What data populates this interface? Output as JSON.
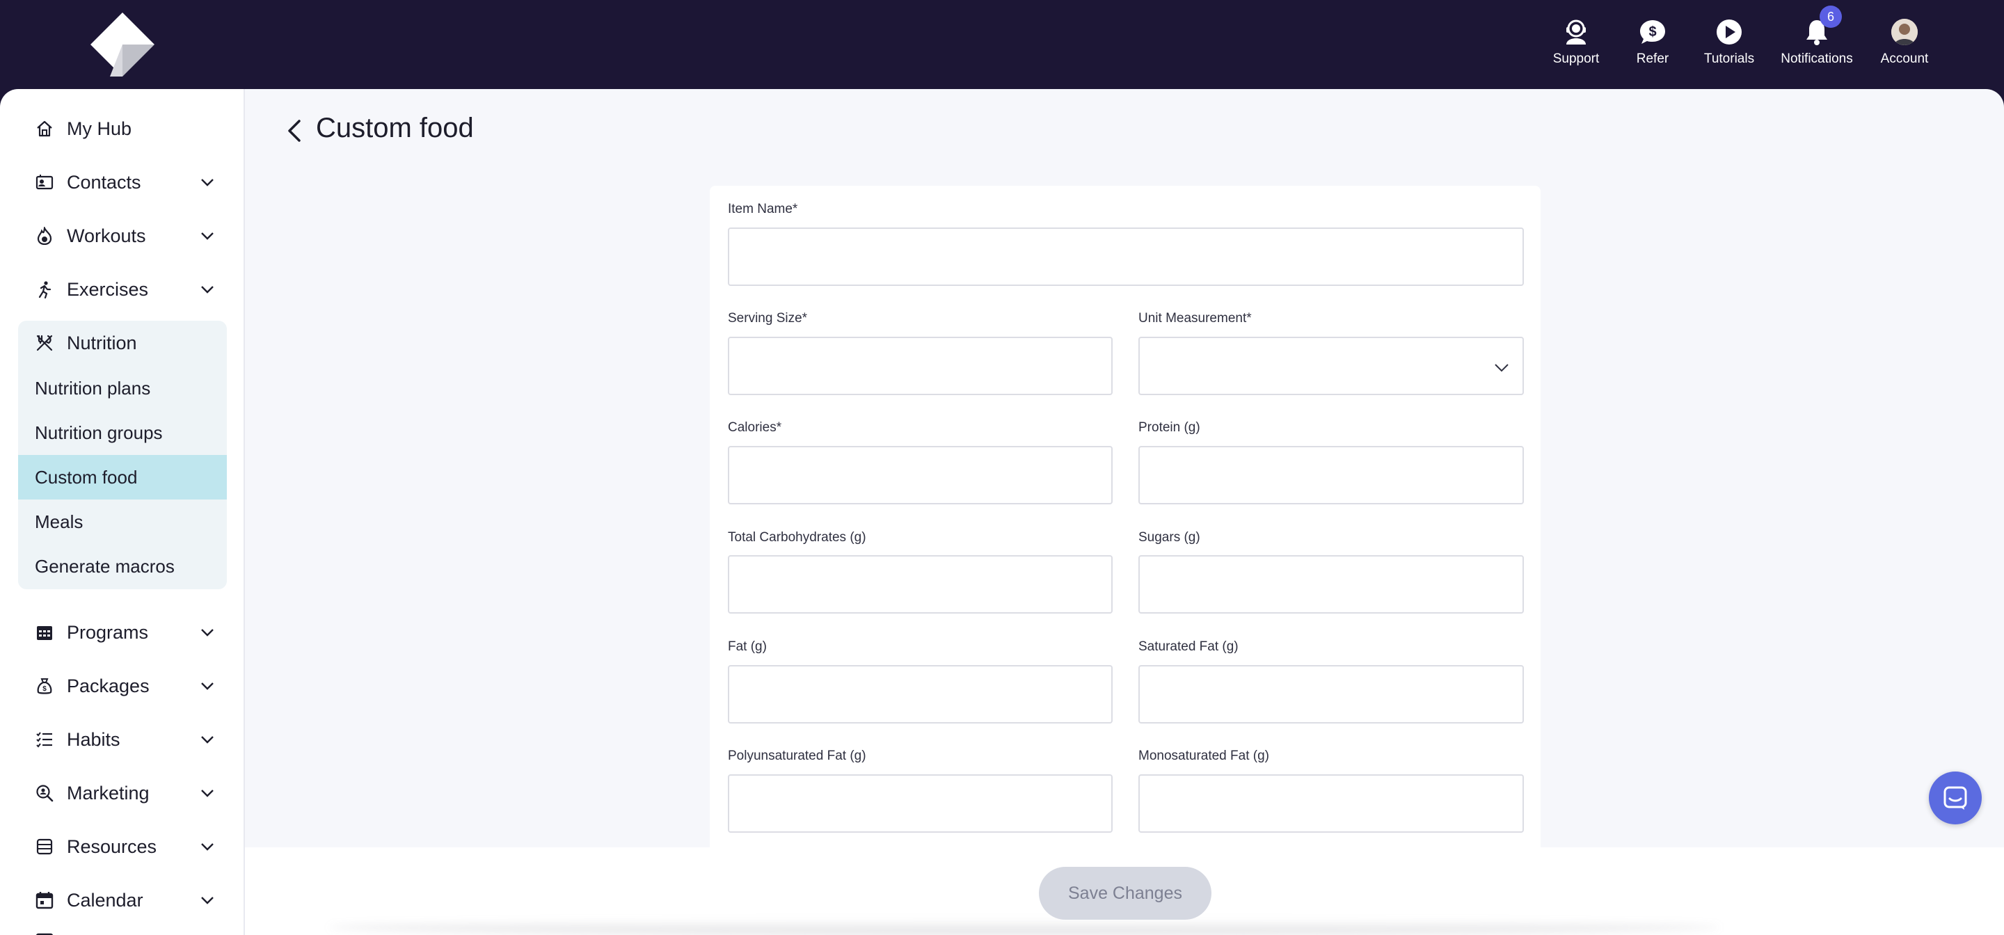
{
  "topnav": {
    "support": "Support",
    "refer": "Refer",
    "tutorials": "Tutorials",
    "notifications": "Notifications",
    "notifications_count": "6",
    "account": "Account"
  },
  "sidebar": {
    "my_hub": "My Hub",
    "contacts": "Contacts",
    "workouts": "Workouts",
    "exercises": "Exercises",
    "nutrition": "Nutrition",
    "nutrition_sub": [
      "Nutrition plans",
      "Nutrition groups",
      "Custom food",
      "Meals",
      "Generate macros"
    ],
    "programs": "Programs",
    "packages": "Packages",
    "habits": "Habits",
    "marketing": "Marketing",
    "resources": "Resources",
    "calendar": "Calendar"
  },
  "page": {
    "title": "Custom food"
  },
  "form": {
    "item_name": {
      "label": "Item Name*",
      "value": ""
    },
    "serving_size": {
      "label": "Serving Size*",
      "value": ""
    },
    "unit_measurement": {
      "label": "Unit Measurement*",
      "value": ""
    },
    "calories": {
      "label": "Calories*",
      "value": ""
    },
    "protein": {
      "label": "Protein (g)",
      "value": ""
    },
    "total_carbs": {
      "label": "Total Carbohydrates (g)",
      "value": ""
    },
    "sugars": {
      "label": "Sugars (g)",
      "value": ""
    },
    "fat": {
      "label": "Fat (g)",
      "value": ""
    },
    "saturated_fat": {
      "label": "Saturated Fat (g)",
      "value": ""
    },
    "polyunsaturated_fat": {
      "label": "Polyunsaturated Fat (g)",
      "value": ""
    },
    "monosaturated_fat": {
      "label": "Monosaturated Fat (g)",
      "value": ""
    }
  },
  "footer": {
    "save_label": "Save Changes"
  },
  "colors": {
    "topbar": "#1c1635",
    "active_sub": "#bfe6ee",
    "accent": "#5b6be0"
  }
}
